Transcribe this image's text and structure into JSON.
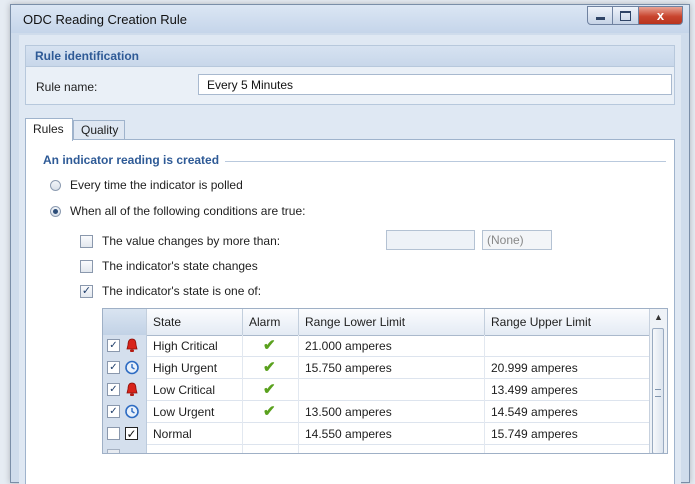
{
  "window": {
    "title": "ODC Reading Creation Rule",
    "close_label": "x"
  },
  "identification": {
    "header": "Rule identification",
    "rule_name_label": "Rule name:",
    "rule_name_value": "Every 5 Minutes"
  },
  "tabs": [
    {
      "label": "Rules",
      "active": true
    },
    {
      "label": "Quality",
      "active": false
    }
  ],
  "rules": {
    "section_title": "An indicator reading is created",
    "radio_every_poll": "Every time the indicator is polled",
    "radio_conditions": "When all of the following conditions are true:",
    "cond_value_changes": "The value changes by more than:",
    "cond_value_unit": "(None)",
    "cond_state_changes": "The indicator's state changes",
    "cond_state_is_one_of": "The indicator's state is one of:"
  },
  "grid": {
    "headers": [
      "State",
      "Alarm",
      "Range Lower Limit",
      "Range Upper Limit"
    ],
    "rows": [
      {
        "checked": true,
        "icon": "red-bell-icon",
        "state": "High Critical",
        "alarm": true,
        "lower": "21.000 amperes",
        "upper": ""
      },
      {
        "checked": true,
        "icon": "blue-clock-icon",
        "state": "High Urgent",
        "alarm": true,
        "lower": "15.750 amperes",
        "upper": "20.999 amperes"
      },
      {
        "checked": true,
        "icon": "red-bell-icon",
        "state": "Low Critical",
        "alarm": true,
        "lower": "",
        "upper": "13.499 amperes"
      },
      {
        "checked": true,
        "icon": "blue-clock-icon",
        "state": "Low Urgent",
        "alarm": true,
        "lower": "13.500 amperes",
        "upper": "14.549 amperes"
      },
      {
        "checked": false,
        "icon": "black-check-icon",
        "state": "Normal",
        "alarm": false,
        "lower": "14.550 amperes",
        "upper": "15.749 amperes"
      },
      {
        "checked": false,
        "icon": "",
        "state": "",
        "alarm": false,
        "lower": "",
        "upper": ""
      },
      {
        "checked": false,
        "icon": "",
        "state": "",
        "alarm": false,
        "lower": "",
        "upper": ""
      }
    ],
    "alarm_glyph": "✔",
    "check_glyph": "✓"
  }
}
